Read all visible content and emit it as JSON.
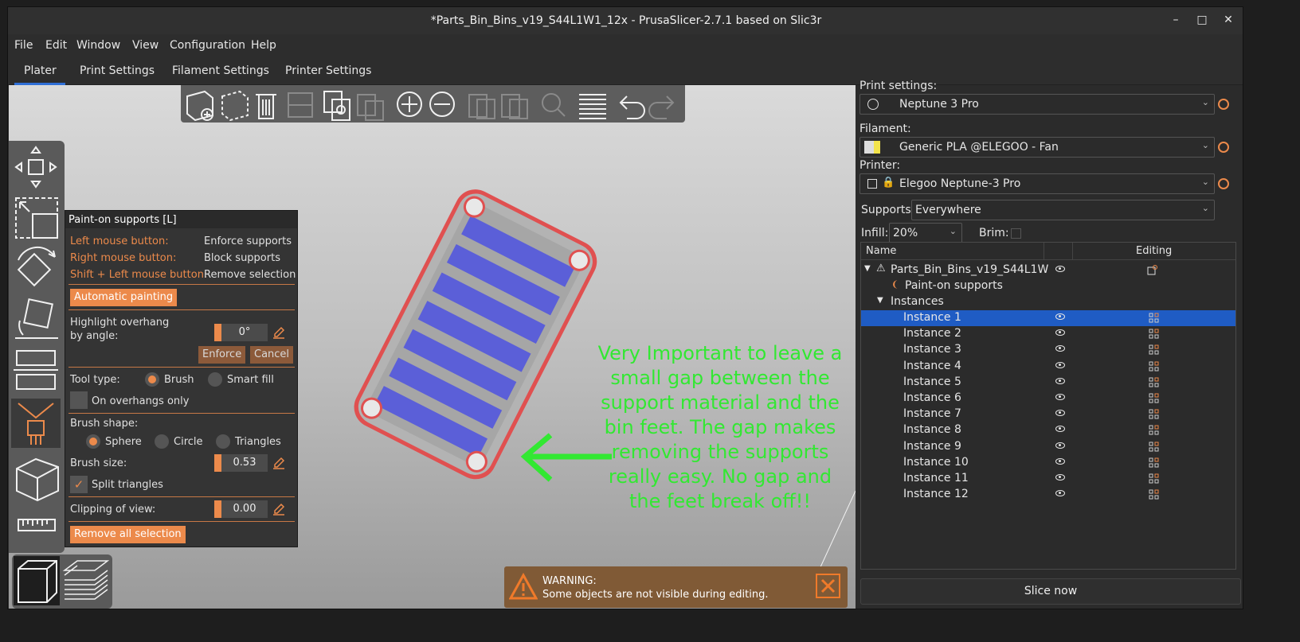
{
  "window": {
    "title": "*Parts_Bin_Bins_v19_S44L1W1_12x - PrusaSlicer-2.7.1 based on Slic3r"
  },
  "menu": [
    "File",
    "Edit",
    "Window",
    "View",
    "Configuration",
    "Help"
  ],
  "tabs": [
    "Plater",
    "Print Settings",
    "Filament Settings",
    "Printer Settings"
  ],
  "gizmo": {
    "title": "Paint-on supports [L]",
    "left_mouse": "Left mouse button:",
    "left_action": "Enforce supports",
    "right_mouse": "Right mouse button:",
    "right_action": "Block supports",
    "shift_left": "Shift + Left mouse button:",
    "shift_action": "Remove selection",
    "auto_paint": "Automatic painting",
    "highlight_label_1": "Highlight overhang",
    "highlight_label_2": "by angle:",
    "angle_value": "0°",
    "enforce": "Enforce",
    "cancel": "Cancel",
    "tool_type": "Tool type:",
    "brush": "Brush",
    "smart_fill": "Smart fill",
    "overhangs_only": "On overhangs only",
    "brush_shape": "Brush shape:",
    "sphere": "Sphere",
    "circle": "Circle",
    "triangles": "Triangles",
    "brush_size": "Brush size:",
    "brush_size_value": "0.53",
    "split_triangles": "Split triangles",
    "clipping": "Clipping of view:",
    "clipping_value": "0.00",
    "remove_all": "Remove all selection"
  },
  "annotation": "Very Important to leave a small gap between the support material and the bin feet.  The gap makes removing the supports really easy. No gap and the feet break off!!",
  "warning": {
    "title": "WARNING:",
    "text": "Some objects are not visible during editing."
  },
  "right": {
    "print_settings_label": "Print settings:",
    "print_profile": "Neptune 3 Pro",
    "filament_label": "Filament:",
    "filament_profile": "Generic PLA @ELEGOO - Fan",
    "printer_label": "Printer:",
    "printer_profile": "Elegoo Neptune-3 Pro",
    "supports_label": "Supports:",
    "supports_value": "Everywhere",
    "infill_label": "Infill:",
    "infill_value": "20%",
    "brim_label": "Brim:",
    "col_name": "Name",
    "col_editing": "Editing",
    "object_name": "Parts_Bin_Bins_v19_S44L1W",
    "paint_supports": "Paint-on supports",
    "instances_label": "Instances",
    "instances": [
      "Instance 1",
      "Instance 2",
      "Instance 3",
      "Instance 4",
      "Instance 5",
      "Instance 6",
      "Instance 7",
      "Instance 8",
      "Instance 9",
      "Instance 10",
      "Instance 11",
      "Instance 12"
    ],
    "slice_now": "Slice now"
  },
  "colors": {
    "accent": "#ec8a4b",
    "selection": "#1f5cc4",
    "annotation": "#32e832",
    "paint_blue": "#5b5fd8"
  }
}
